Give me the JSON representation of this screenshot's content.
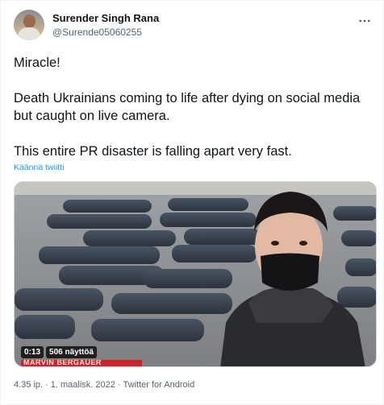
{
  "author": {
    "display_name": "Surender Singh Rana",
    "handle": "@Surende05060255"
  },
  "tweet": {
    "paragraphs": [
      "Miracle!",
      "Death Ukrainians coming to life after dying on social media but caught on live camera.",
      "This entire PR disaster is falling apart very fast."
    ],
    "translate_label": "Käännä twiitti"
  },
  "media": {
    "duration": "0:13",
    "views": "506 näyttöä",
    "chyron_text": "MARVIN BERGAUER"
  },
  "meta": {
    "time": "4.35 ip.",
    "date": "1. maalisk. 2022",
    "source": "Twitter for Android"
  },
  "icons": {
    "more": "more-options-icon"
  }
}
